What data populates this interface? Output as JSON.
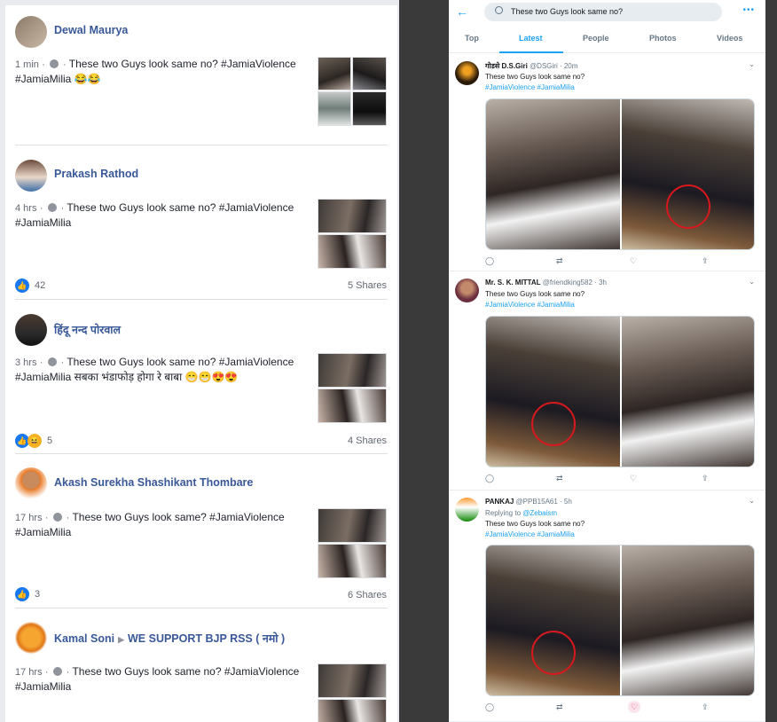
{
  "facebook": {
    "posts": [
      {
        "name": "Dewal Maurya",
        "time": "1 min",
        "text": "These two Guys look same no? #JamiaViolence #JamiaMilia 😂😂",
        "likes": "",
        "shares": ""
      },
      {
        "name": "Prakash Rathod",
        "time": "4 hrs",
        "text": "These two Guys look same no? #JamiaViolence #JamiaMilia",
        "likes": "42",
        "shares": "5 Shares"
      },
      {
        "name": "हिंदू नन्द पोरवाल",
        "time": "3 hrs",
        "text": "These two Guys look same no? #JamiaViolence #JamiaMilia सबका भंडाफोड़ होगा रे बाबा 😁😁😍😍",
        "likes": "5",
        "shares": "4 Shares"
      },
      {
        "name": "Akash Surekha Shashikant Thombare",
        "time": "17 hrs",
        "text": "These two Guys look same? #JamiaViolence #JamiaMilia",
        "likes": "3",
        "shares": "6 Shares"
      },
      {
        "name": "Kamal Soni",
        "group": "WE SUPPORT BJP RSS ( नमो )",
        "time": "17 hrs",
        "text": "These two Guys look same no? #JamiaViolence #JamiaMilia",
        "likes": "",
        "shares": ""
      }
    ]
  },
  "twitter": {
    "search_query": "These two Guys look same no?",
    "tabs": [
      "Top",
      "Latest",
      "People",
      "Photos",
      "Videos"
    ],
    "active_tab": "Latest",
    "tweets": [
      {
        "name": "गोडसे D.S.Giri",
        "handle": "@DSGiri",
        "time": "20m",
        "reply_to": "",
        "text": "These two Guys look same no?",
        "tags": "#JamiaViolence #JamiaMilia"
      },
      {
        "name": "Mr. S. K. MITTAL",
        "handle": "@friendking582",
        "time": "3h",
        "reply_to": "",
        "text": "These two Guys look same no?",
        "tags": "#JamiaViolence #JamiaMilia"
      },
      {
        "name": "PANKAJ",
        "handle": "@PPB15A61",
        "time": "5h",
        "reply_to_prefix": "Replying to",
        "reply_to": "@Zebaism",
        "text": "These two Guys look same no?",
        "tags": "#JamiaViolence #JamiaMilia"
      }
    ]
  },
  "colors": {
    "fb_link": "#385898",
    "tw_blue": "#1da1f2",
    "highlight_red": "#d9181e"
  }
}
